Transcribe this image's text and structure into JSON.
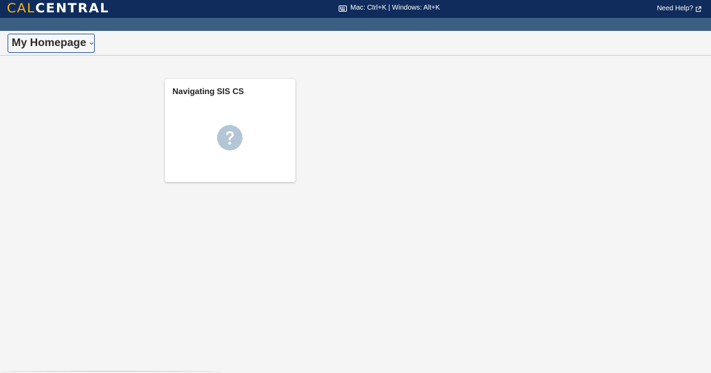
{
  "header": {
    "logo_cal": "CAL",
    "logo_central": "CENTRAL",
    "shortcut_text": "Mac: Ctrl+K | Windows: Alt+K",
    "help_label": "Need Help?",
    "keyboard_icon": "keyboard-icon",
    "external_icon": "external-link-icon"
  },
  "page": {
    "homepage_select": "My Homepage",
    "chevron_icon": "chevron-down-icon"
  },
  "tiles": [
    {
      "title": "Navigating SIS CS",
      "icon": "question-circle-icon"
    }
  ],
  "colors": {
    "topbar": "#0f2c5c",
    "subbar": "#3b5f82",
    "logo_accent": "#fdb515",
    "select_border": "#2a5cab",
    "tile_icon": "#b3c6d6",
    "background": "#f5f5f5"
  }
}
